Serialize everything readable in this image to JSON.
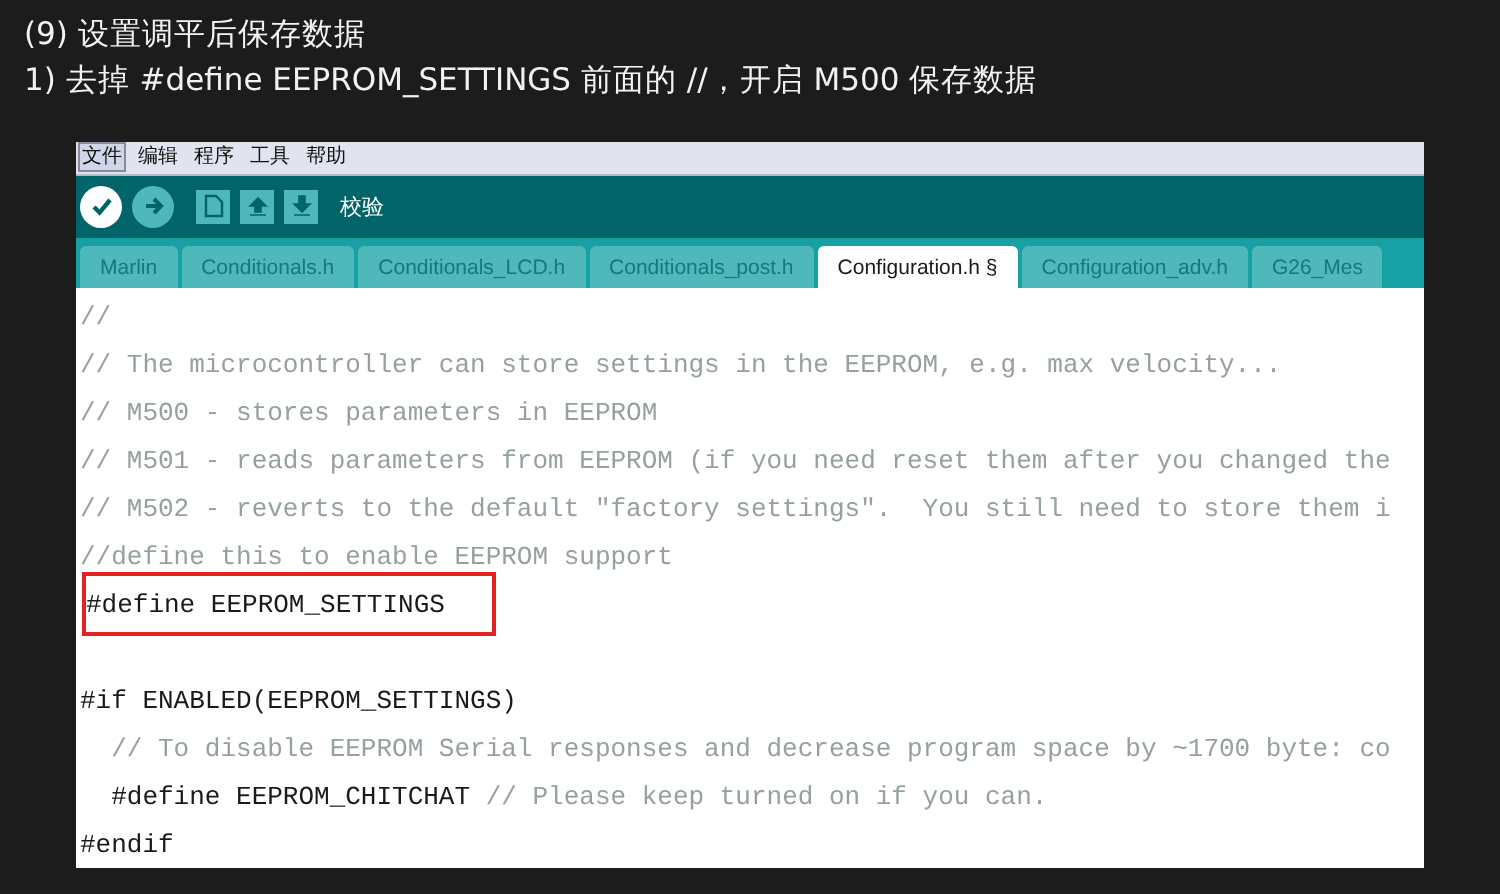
{
  "heading": {
    "lines": [
      "(9) 设置调平后保存数据",
      "1) 去掉 #define EEPROM_SETTINGS 前面的 //，开启 M500 保存数据"
    ]
  },
  "menu_bar": [
    {
      "label": "文件",
      "selected": true
    },
    {
      "label": "编辑",
      "selected": false
    },
    {
      "label": "程序",
      "selected": false
    },
    {
      "label": "工具",
      "selected": false
    },
    {
      "label": "帮助",
      "selected": false
    }
  ],
  "toolbar": {
    "buttons": [
      {
        "kind": "verify"
      },
      {
        "kind": "upload"
      },
      {
        "kind": "new"
      },
      {
        "kind": "open"
      },
      {
        "kind": "save"
      }
    ],
    "hint": "校验"
  },
  "tabs": [
    {
      "label": "Marlin",
      "selected": false
    },
    {
      "label": "Conditionals.h",
      "selected": false
    },
    {
      "label": "Conditionals_LCD.h",
      "selected": false
    },
    {
      "label": "Conditionals_post.h",
      "selected": false
    },
    {
      "label": "Configuration.h §",
      "selected": true
    },
    {
      "label": "Configuration_adv.h",
      "selected": false
    },
    {
      "label": "G26_Mes",
      "selected": false
    }
  ],
  "code": [
    {
      "highlighted": false,
      "segments": [
        {
          "kind": "comment",
          "text": "//"
        }
      ]
    },
    {
      "highlighted": false,
      "segments": [
        {
          "kind": "comment",
          "text": "// The microcontroller can store settings in the EEPROM, e.g. max velocity..."
        }
      ]
    },
    {
      "highlighted": false,
      "segments": [
        {
          "kind": "comment",
          "text": "// M500 - stores parameters in EEPROM"
        }
      ]
    },
    {
      "highlighted": false,
      "segments": [
        {
          "kind": "comment",
          "text": "// M501 - reads parameters from EEPROM (if you need reset them after you changed the"
        }
      ]
    },
    {
      "highlighted": false,
      "segments": [
        {
          "kind": "comment",
          "text": "// M502 - reverts to the default \"factory settings\".  You still need to store them i"
        }
      ]
    },
    {
      "highlighted": false,
      "segments": [
        {
          "kind": "comment",
          "text": "//define this to enable EEPROM support"
        }
      ]
    },
    {
      "highlighted": true,
      "segments": [
        {
          "kind": "code",
          "text": "#define EEPROM_SETTINGS"
        }
      ]
    },
    {
      "highlighted": false
    },
    {
      "highlighted": false,
      "segments": [
        {
          "kind": "code",
          "text": "#if ENABLED(EEPROM_SETTINGS)"
        }
      ]
    },
    {
      "highlighted": false,
      "segments": [
        {
          "kind": "comment",
          "text": "  // To disable EEPROM Serial responses and decrease program space by ~1700 byte: co"
        }
      ]
    },
    {
      "highlighted": false,
      "segments": [
        {
          "kind": "code",
          "text": "  #define EEPROM_CHITCHAT "
        },
        {
          "kind": "comment",
          "text": "// Please keep turned on if you can."
        }
      ]
    },
    {
      "highlighted": false,
      "segments": [
        {
          "kind": "code",
          "text": "#endif"
        }
      ]
    }
  ]
}
